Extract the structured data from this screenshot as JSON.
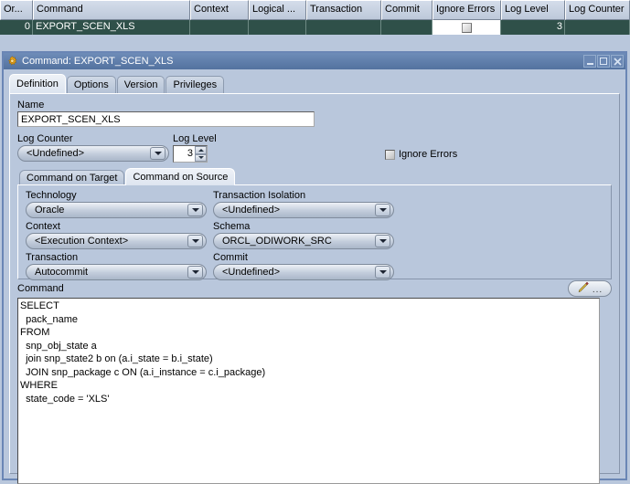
{
  "grid": {
    "columns": [
      "Or...",
      "Command",
      "Context",
      "Logical ...",
      "Transaction",
      "Commit",
      "Ignore Errors",
      "Log Level",
      "Log Counter"
    ],
    "rows": [
      {
        "order": "0",
        "command": "EXPORT_SCEN_XLS",
        "context": "",
        "logical": "",
        "transaction": "",
        "commit": "",
        "ignore_errors_checked": false,
        "log_level": "3",
        "log_counter": ""
      }
    ]
  },
  "dialog": {
    "title": "Command: EXPORT_SCEN_XLS",
    "icon": "gear-icon",
    "window_buttons": {
      "minimize": "_",
      "maximize": "□",
      "close": "✕"
    },
    "tabs": [
      {
        "label": "Definition",
        "active": true
      },
      {
        "label": "Options",
        "active": false
      },
      {
        "label": "Version",
        "active": false
      },
      {
        "label": "Privileges",
        "active": false
      }
    ],
    "definition": {
      "name_label": "Name",
      "name_value": "EXPORT_SCEN_XLS",
      "log_counter_label": "Log Counter",
      "log_counter_value": "<Undefined>",
      "log_level_label": "Log Level",
      "log_level_value": "3",
      "ignore_errors_label": "Ignore Errors",
      "ignore_errors_checked": false,
      "inner_tabs": [
        {
          "label": "Command on Target",
          "active": false
        },
        {
          "label": "Command on Source",
          "active": true
        }
      ],
      "technology_label": "Technology",
      "technology_value": "Oracle",
      "transaction_isolation_label": "Transaction Isolation",
      "transaction_isolation_value": "<Undefined>",
      "context_label": "Context",
      "context_value": "<Execution Context>",
      "schema_label": "Schema",
      "schema_value": "ORCL_ODIWORK_SRC",
      "transaction_label": "Transaction",
      "transaction_value": "Autocommit",
      "commit_label": "Commit",
      "commit_value": "<Undefined>",
      "command_label": "Command",
      "command_edit_button": "...",
      "command_text": "SELECT\n  pack_name\nFROM\n  snp_obj_state a\n  join snp_state2 b on (a.i_state = b.i_state)\n  JOIN snp_package c ON (a.i_instance = c.i_package)\nWHERE\n  state_code = 'XLS'"
    }
  },
  "colors": {
    "window_background": "#b9c7dc",
    "titlebar": "#53729f",
    "selected_row": "#2f5049",
    "grid_header": "#c8d2e0"
  }
}
